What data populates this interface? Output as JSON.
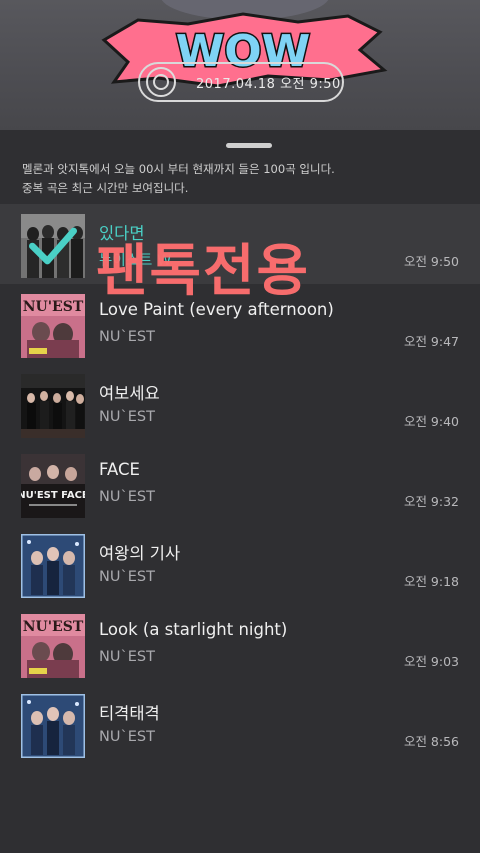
{
  "header": {
    "sticker_text": "WOW",
    "timestamp": "2017.04.18 오전 9:50"
  },
  "notice": {
    "line1": "멜론과 앗지톡에서 오늘 00시 부터 현재까지 들은 100곡 입니다.",
    "line2": "중복 곡은 최근 시간만 보여집니다."
  },
  "watermark": "팬톡전용",
  "colors": {
    "selected_text": "#4ad0c6",
    "watermark": "#ff6f6f",
    "sticker_fill": "#ff6f8e",
    "sticker_text": "#7fd3f5"
  },
  "songs": [
    {
      "title": "있다면",
      "artist": "뉴이스트 W",
      "time": "오전 9:50",
      "selected": true,
      "cover": "group-photo-gray"
    },
    {
      "title": "Love Paint (every afternoon)",
      "artist": "NU`EST",
      "time": "오전 9:47",
      "selected": false,
      "cover": "face-album-pink"
    },
    {
      "title": "여보세요",
      "artist": "NU`EST",
      "time": "오전 9:40",
      "selected": false,
      "cover": "group-photo-dark"
    },
    {
      "title": "FACE",
      "artist": "NU`EST",
      "time": "오전 9:32",
      "selected": false,
      "cover": "face-album-black"
    },
    {
      "title": "여왕의 기사",
      "artist": "NU`EST",
      "time": "오전 9:18",
      "selected": false,
      "cover": "queen-knight-blue"
    },
    {
      "title": "Look (a starlight night)",
      "artist": "NU`EST",
      "time": "오전 9:03",
      "selected": false,
      "cover": "face-album-pink"
    },
    {
      "title": "티격태격",
      "artist": "NU`EST",
      "time": "오전 8:56",
      "selected": false,
      "cover": "queen-knight-blue"
    }
  ]
}
